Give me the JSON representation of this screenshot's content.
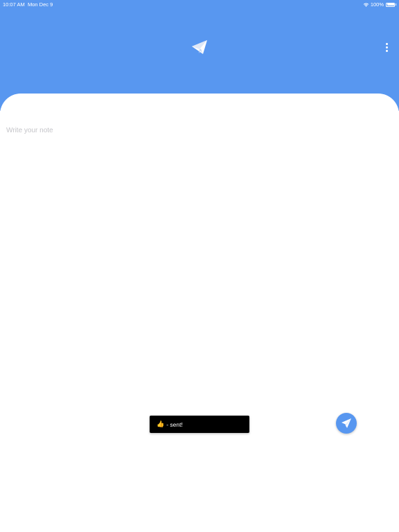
{
  "status_bar": {
    "time": "10:07 AM",
    "date": "Mon Dec 9",
    "battery": "100%"
  },
  "header": {
    "logo_icon": "paper-plane-icon",
    "menu_icon": "more-vertical-icon"
  },
  "note": {
    "placeholder": "Write your note",
    "value": ""
  },
  "toast": {
    "emoji": "👍",
    "text": "- sent!"
  },
  "send_button": {
    "icon": "send-icon"
  },
  "colors": {
    "brand": "#5897f0",
    "background": "#ffffff",
    "toast_background": "#000000",
    "placeholder": "#c4c4c8"
  }
}
